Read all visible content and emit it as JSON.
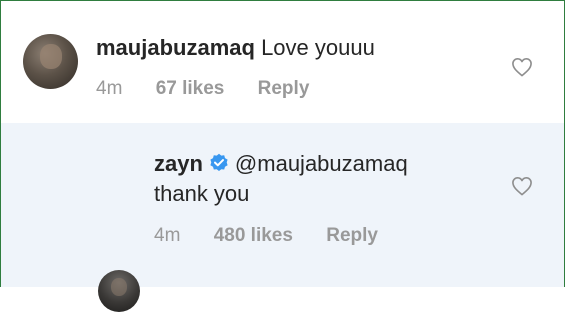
{
  "comment": {
    "username": "maujabuzamaq",
    "text": "Love youuu",
    "time": "4m",
    "likes": "67 likes",
    "reply_label": "Reply"
  },
  "reply": {
    "username": "zayn",
    "verified": true,
    "mention": "@maujabuzamaq",
    "text": "thank you",
    "time": "4m",
    "likes": "480 likes",
    "reply_label": "Reply"
  },
  "icons": {
    "like": "heart-icon",
    "verified": "verified-badge-icon"
  },
  "colors": {
    "verified_blue": "#3897f0",
    "reply_background": "#eff4fa",
    "meta_gray": "#999999",
    "border_green": "#2f7d3f"
  }
}
